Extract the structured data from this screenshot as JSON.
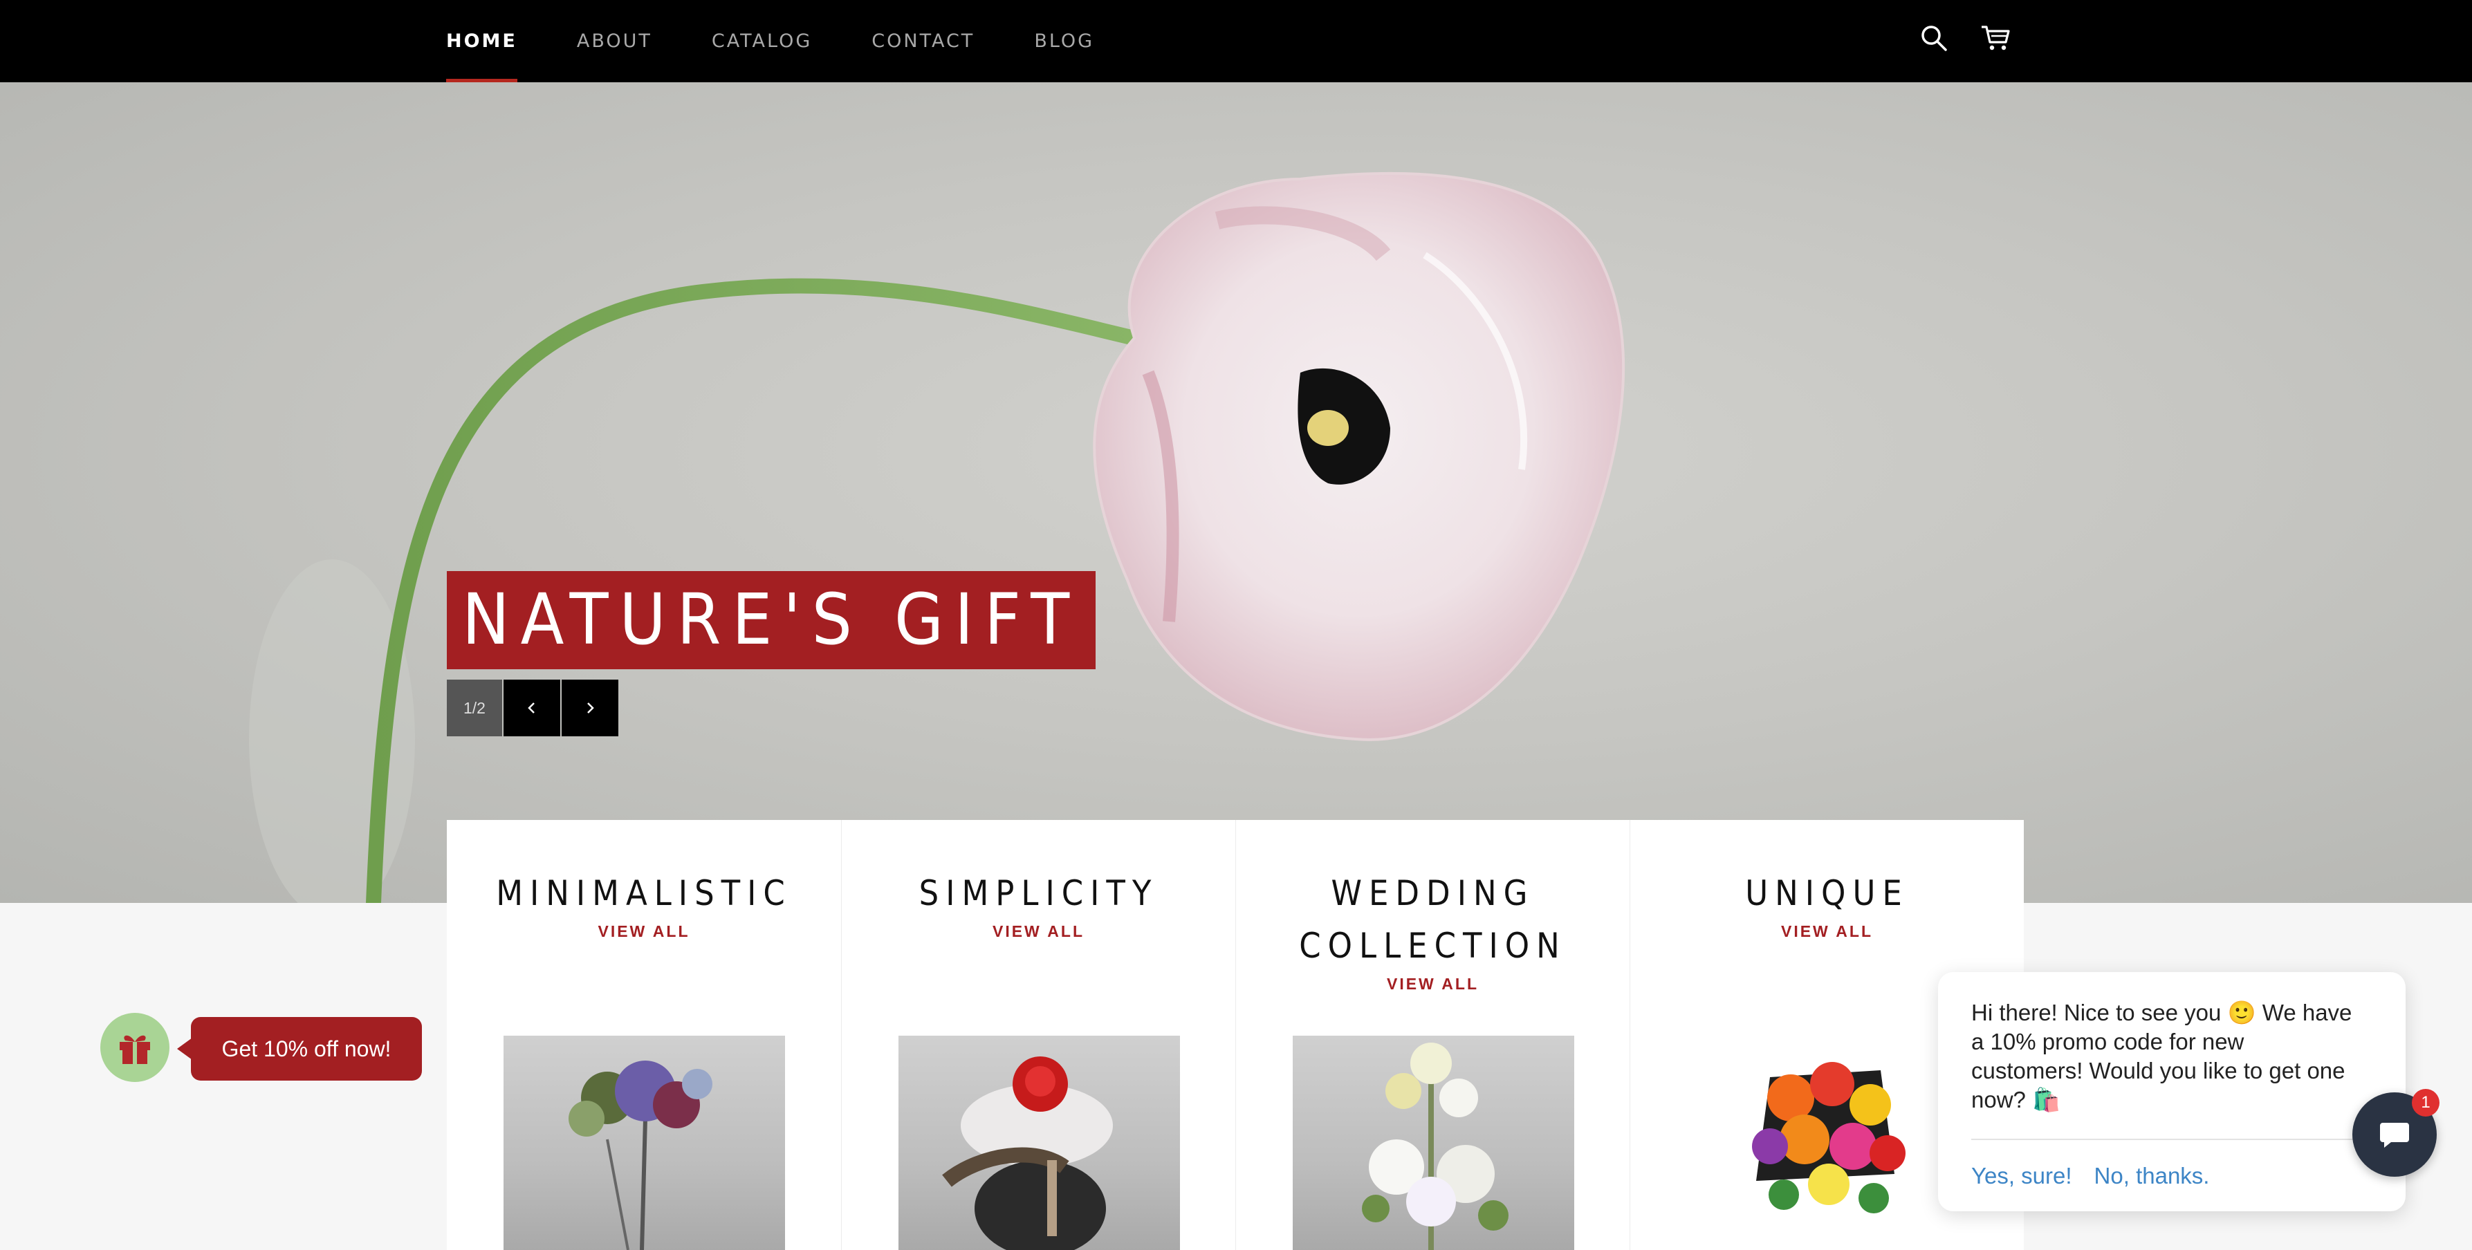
{
  "nav": {
    "links": [
      "HOME",
      "ABOUT",
      "CATALOG",
      "CONTACT",
      "BLOG"
    ],
    "active": "HOME"
  },
  "hero": {
    "title": "NATURE'S GIFT",
    "slide_indicator": "1/2",
    "title_bg_color": "#a31f22"
  },
  "collections": [
    {
      "title": "MINIMALISTIC",
      "link": "VIEW ALL"
    },
    {
      "title": "SIMPLICITY",
      "link": "VIEW ALL"
    },
    {
      "title": "WEDDING COLLECTION",
      "link": "VIEW ALL"
    },
    {
      "title": "UNIQUE",
      "link": "VIEW ALL"
    }
  ],
  "promo": {
    "button_label": "Get 10% off now!"
  },
  "chat": {
    "message": "Hi there! Nice to see you 🙂 We have a 10% promo code for new customers! Would you like to get one now? 🛍️",
    "yes_label": "Yes, sure!",
    "no_label": "No, thanks.",
    "unread_count": "1"
  },
  "colors": {
    "accent": "#a31f22",
    "nav_bg": "#000000",
    "link_blue": "#3d85c6"
  },
  "icons": [
    "search-icon",
    "cart-icon",
    "chevron-left-icon",
    "chevron-right-icon",
    "gift-icon",
    "chat-bubble-icon"
  ]
}
